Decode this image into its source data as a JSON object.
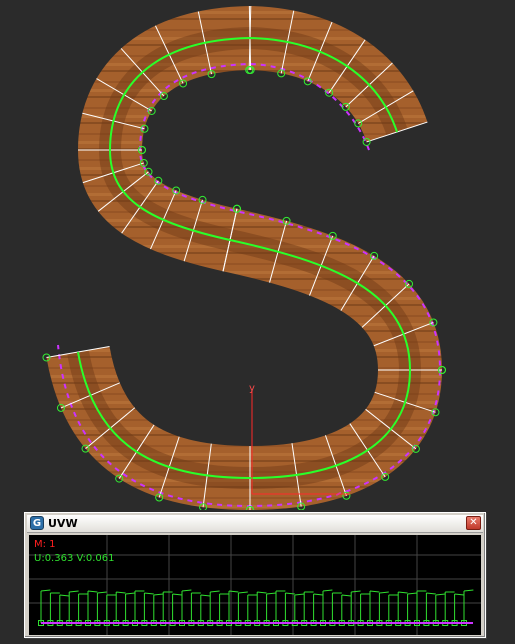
{
  "uvw_window": {
    "title": "UVW",
    "app_icon": "G",
    "close_glyph": "✕",
    "material_readout": "M: 1",
    "uv_readout": "U:0.363 V:0.061"
  },
  "viewport": {
    "axis_label": "y"
  },
  "colors": {
    "background": "#2b2b2b",
    "wood": "#a5602c",
    "wood_dark": "#6e3a16",
    "seam": "#2aff2a",
    "edge": "#cc33ff",
    "vertex": "#33ee33",
    "grid_lines": "#ffffff",
    "axis": "#ff2a2a"
  }
}
